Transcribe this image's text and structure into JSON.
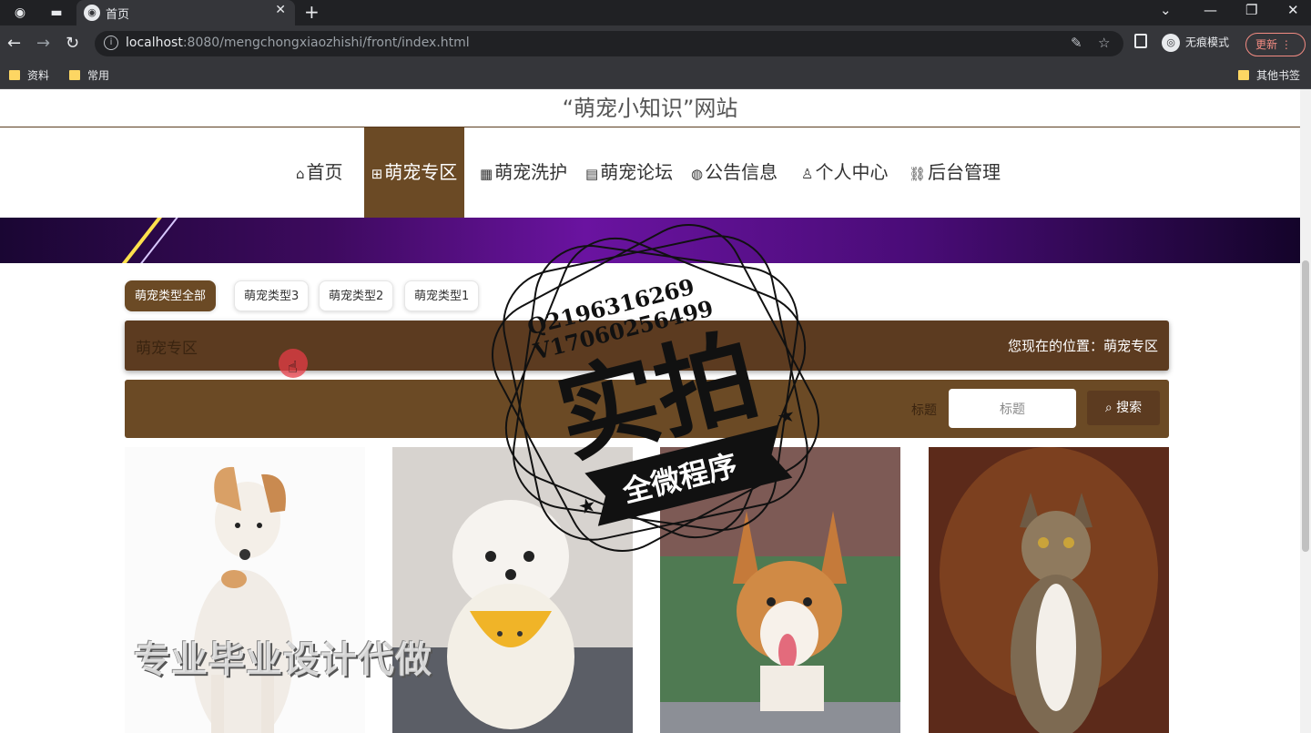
{
  "browser": {
    "tab_title": "首页",
    "url_host": "localhost",
    "url_rest": ":8080/mengchongxiaozhishi/front/index.html",
    "incognito_label": "无痕模式",
    "update_label": "更新",
    "bookmarks": [
      "资料",
      "常用"
    ],
    "other_bookmarks": "其他书签"
  },
  "site": {
    "title": "“萌宠小知识”网站"
  },
  "nav": [
    {
      "icon": "⌂",
      "label": "首页"
    },
    {
      "icon": "⊞",
      "label": "萌宠专区"
    },
    {
      "icon": "▦",
      "label": "萌宠洗护"
    },
    {
      "icon": "▤",
      "label": "萌宠论坛"
    },
    {
      "icon": "◍",
      "label": "公告信息"
    },
    {
      "icon": "♙",
      "label": "个人中心"
    },
    {
      "icon": "⛓",
      "label": "后台管理"
    }
  ],
  "categories": [
    "萌宠类型全部",
    "萌宠类型3",
    "萌宠类型2",
    "萌宠类型1"
  ],
  "location_bar": {
    "title": "萌宠专区",
    "location": "您现在的位置：萌宠专区"
  },
  "search": {
    "label": "标题",
    "placeholder": "标题",
    "button": "搜索"
  },
  "watermark": {
    "contact1": "Q2196316269",
    "contact2": "V17060256499",
    "big": "实拍",
    "ribbon": "全微程序",
    "bottom": "专业毕业设计代做"
  },
  "colors": {
    "brown_dark": "#5c3b20",
    "brown": "#6b4a25",
    "banner_purple": "#6a13a0"
  }
}
